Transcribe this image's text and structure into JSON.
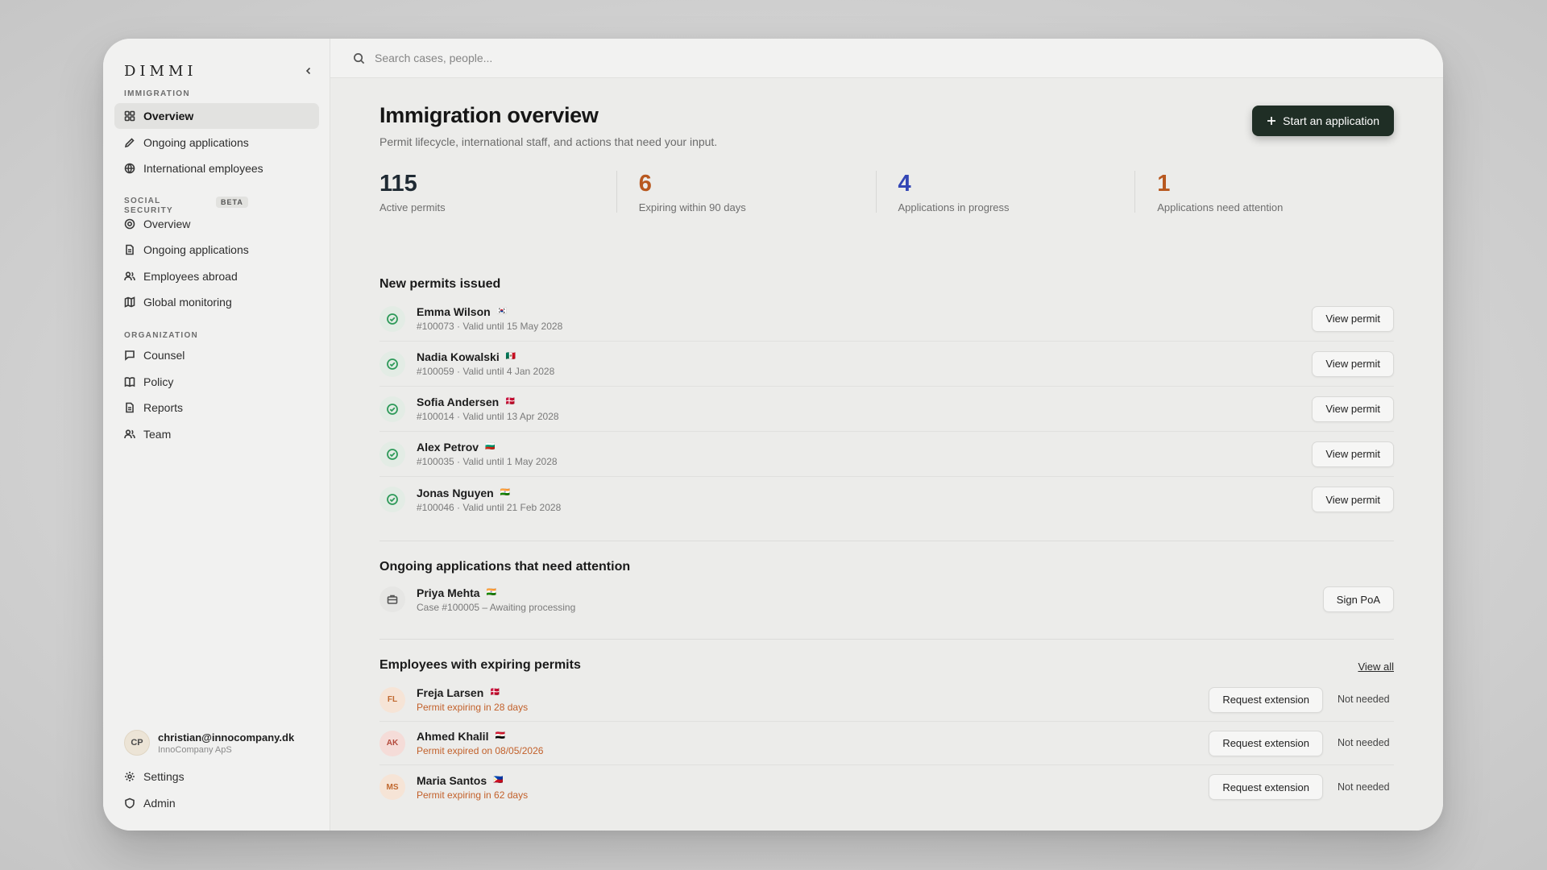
{
  "sidebar": {
    "brand": "DIMMI",
    "immigration_label": "IMMIGRATION",
    "immigration_items": [
      {
        "label": "Overview"
      },
      {
        "label": "Ongoing applications"
      },
      {
        "label": "International employees"
      }
    ],
    "social_label": "SOCIAL SECURITY",
    "beta": "BETA",
    "social_items": [
      {
        "label": "Overview"
      },
      {
        "label": "Ongoing applications"
      },
      {
        "label": "Employees abroad"
      },
      {
        "label": "Global monitoring"
      }
    ],
    "org_label": "ORGANIZATION",
    "org_items": [
      {
        "label": "Counsel"
      },
      {
        "label": "Policy"
      },
      {
        "label": "Reports"
      },
      {
        "label": "Team"
      }
    ],
    "user": {
      "initials": "CP",
      "email": "christian@innocompany.dk",
      "org": "InnoCompany ApS"
    },
    "footer_items": [
      {
        "label": "Settings"
      },
      {
        "label": "Admin"
      }
    ]
  },
  "search": {
    "placeholder": "Search cases, people..."
  },
  "header": {
    "title": "Immigration overview",
    "subtitle": "Permit lifecycle, international staff, and actions that need your input.",
    "start_button": "Start an application"
  },
  "stats": [
    {
      "value": "115",
      "label": "Active permits",
      "color": "#1f2a33"
    },
    {
      "value": "6",
      "label": "Expiring within 90 days",
      "color": "#b8581f"
    },
    {
      "value": "4",
      "label": "Applications in progress",
      "color": "#3346b5"
    },
    {
      "value": "1",
      "label": "Applications need attention",
      "color": "#b8581f"
    }
  ],
  "new_permits": {
    "title": "New permits issued",
    "button": "View permit",
    "items": [
      {
        "name": "Emma Wilson",
        "flag": "🇰🇷",
        "detail": "#100073 · Valid until 15 May 2028"
      },
      {
        "name": "Nadia Kowalski",
        "flag": "🇲🇽",
        "detail": "#100059 · Valid until 4 Jan 2028"
      },
      {
        "name": "Sofia Andersen",
        "flag": "🇩🇰",
        "detail": "#100014 · Valid until 13 Apr 2028"
      },
      {
        "name": "Alex Petrov",
        "flag": "🇧🇬",
        "detail": "#100035 · Valid until 1 May 2028"
      },
      {
        "name": "Jonas Nguyen",
        "flag": "🇮🇳",
        "detail": "#100046 · Valid until 21 Feb 2028"
      }
    ]
  },
  "attention": {
    "title": "Ongoing applications that need attention",
    "items": [
      {
        "name": "Priya Mehta",
        "flag": "🇮🇳",
        "detail": "Case #100005 – Awaiting processing",
        "button": "Sign PoA"
      }
    ]
  },
  "expiring": {
    "title": "Employees with expiring permits",
    "view_all": "View all",
    "button": "Request extension",
    "not_needed": "Not needed",
    "items": [
      {
        "initials": "FL",
        "name": "Freja Larsen",
        "flag": "🇩🇰",
        "detail": "Permit expiring in 28 days",
        "avatar_bg": "#f6e4d6",
        "avatar_color": "#c0682f"
      },
      {
        "initials": "AK",
        "name": "Ahmed Khalil",
        "flag": "🇪🇬",
        "detail": "Permit expired on 08/05/2026",
        "avatar_bg": "#f5dcd8",
        "avatar_color": "#b34a3c"
      },
      {
        "initials": "MS",
        "name": "Maria Santos",
        "flag": "🇵🇭",
        "detail": "Permit expiring in 62 days",
        "avatar_bg": "#f6e4d6",
        "avatar_color": "#c0682f"
      }
    ]
  }
}
